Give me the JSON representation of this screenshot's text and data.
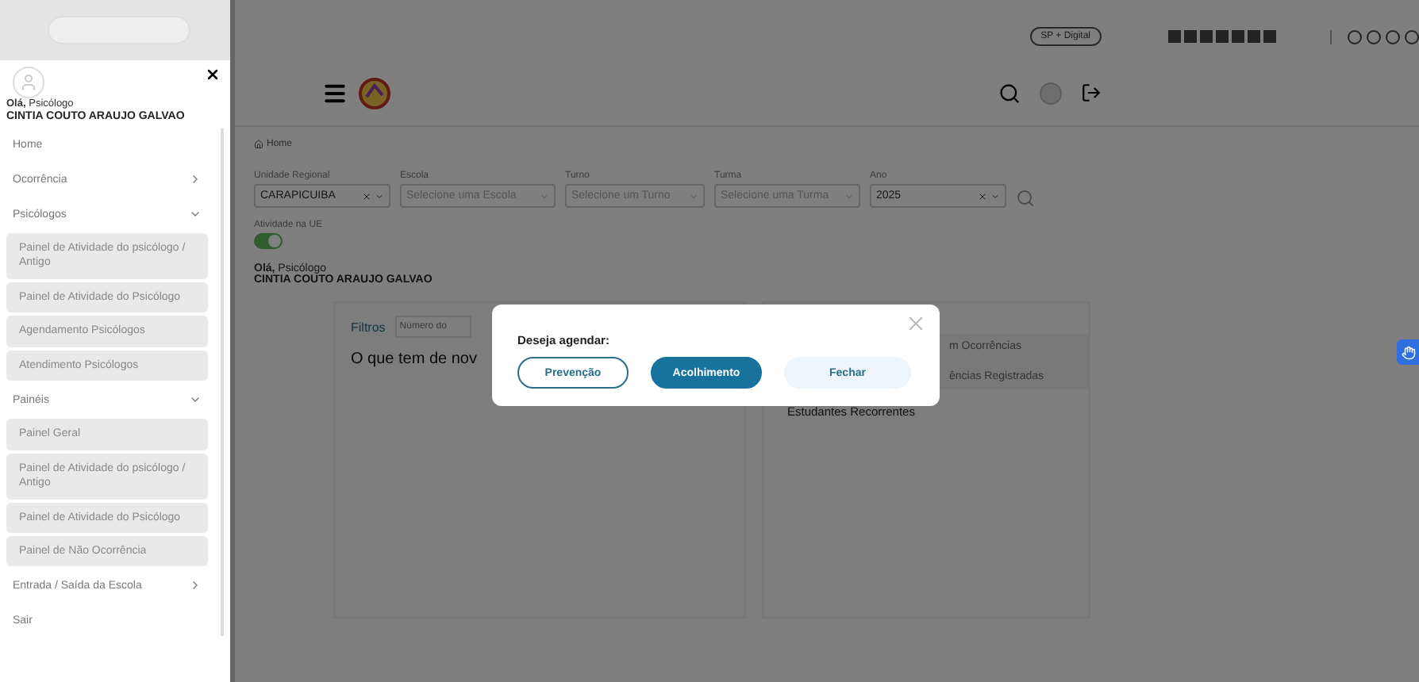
{
  "sidebar": {
    "greeting": "**Olá,** Psicólogo",
    "user_name": "CINTIA COUTO ARAUJO GALVAO",
    "items": [
      {
        "label": "Home",
        "kind": "link"
      },
      {
        "label": "Ocorrência",
        "kind": "group",
        "expanded": false
      },
      {
        "label": "Psicólogos",
        "kind": "group",
        "expanded": true,
        "children": [
          "Painel de Atividade do psicólogo / Antigo",
          "Painel de Atividade do Psicólogo",
          "Agendamento Psicólogos",
          "Atendimento Psicólogos"
        ]
      },
      {
        "label": "Painéis",
        "kind": "group",
        "expanded": true,
        "children": [
          "Painel Geral",
          "Painel de Atividade do psicólogo / Antigo",
          "Painel de Atividade do Psicólogo",
          "Painel de Não Ocorrência"
        ]
      },
      {
        "label": "Entrada / Saída da Escola",
        "kind": "group",
        "expanded": false
      },
      {
        "label": "Sair",
        "kind": "link"
      }
    ]
  },
  "top_bar": {
    "badge": "SP + Digital"
  },
  "breadcrumb": "Home",
  "filters": [
    {
      "label": "Unidade Regional",
      "value": "CARAPICUIBA"
    },
    {
      "label": "Escola",
      "placeholder": "Selecione uma Escola"
    },
    {
      "label": "Turno",
      "placeholder": "Selecione um Turno"
    },
    {
      "label": "Turma",
      "placeholder": "Selecione uma Turma"
    },
    {
      "label": "Ano",
      "value": "2025"
    }
  ],
  "activity_toggle": {
    "label": "Atividade na UE",
    "on": true
  },
  "greeting": {
    "text": "**Olá,** Psicólogo",
    "user_name": "CINTIA COUTO ARAUJO GALVAO"
  },
  "news_card": {
    "tab": "Filtros",
    "search_placeholder": "Número do",
    "title": "O que tem de nov"
  },
  "stats_card": {
    "rows": [
      "m Ocorrências",
      "ências Registradas"
    ],
    "heading": "Estudantes Recorrentes"
  },
  "dialog": {
    "title": "Deseja agendar:",
    "buttons": [
      {
        "label": "Prevenção",
        "kind": "outline"
      },
      {
        "label": "Acolhimento",
        "kind": "primary"
      },
      {
        "label": "Fechar",
        "kind": "ghost"
      }
    ]
  }
}
